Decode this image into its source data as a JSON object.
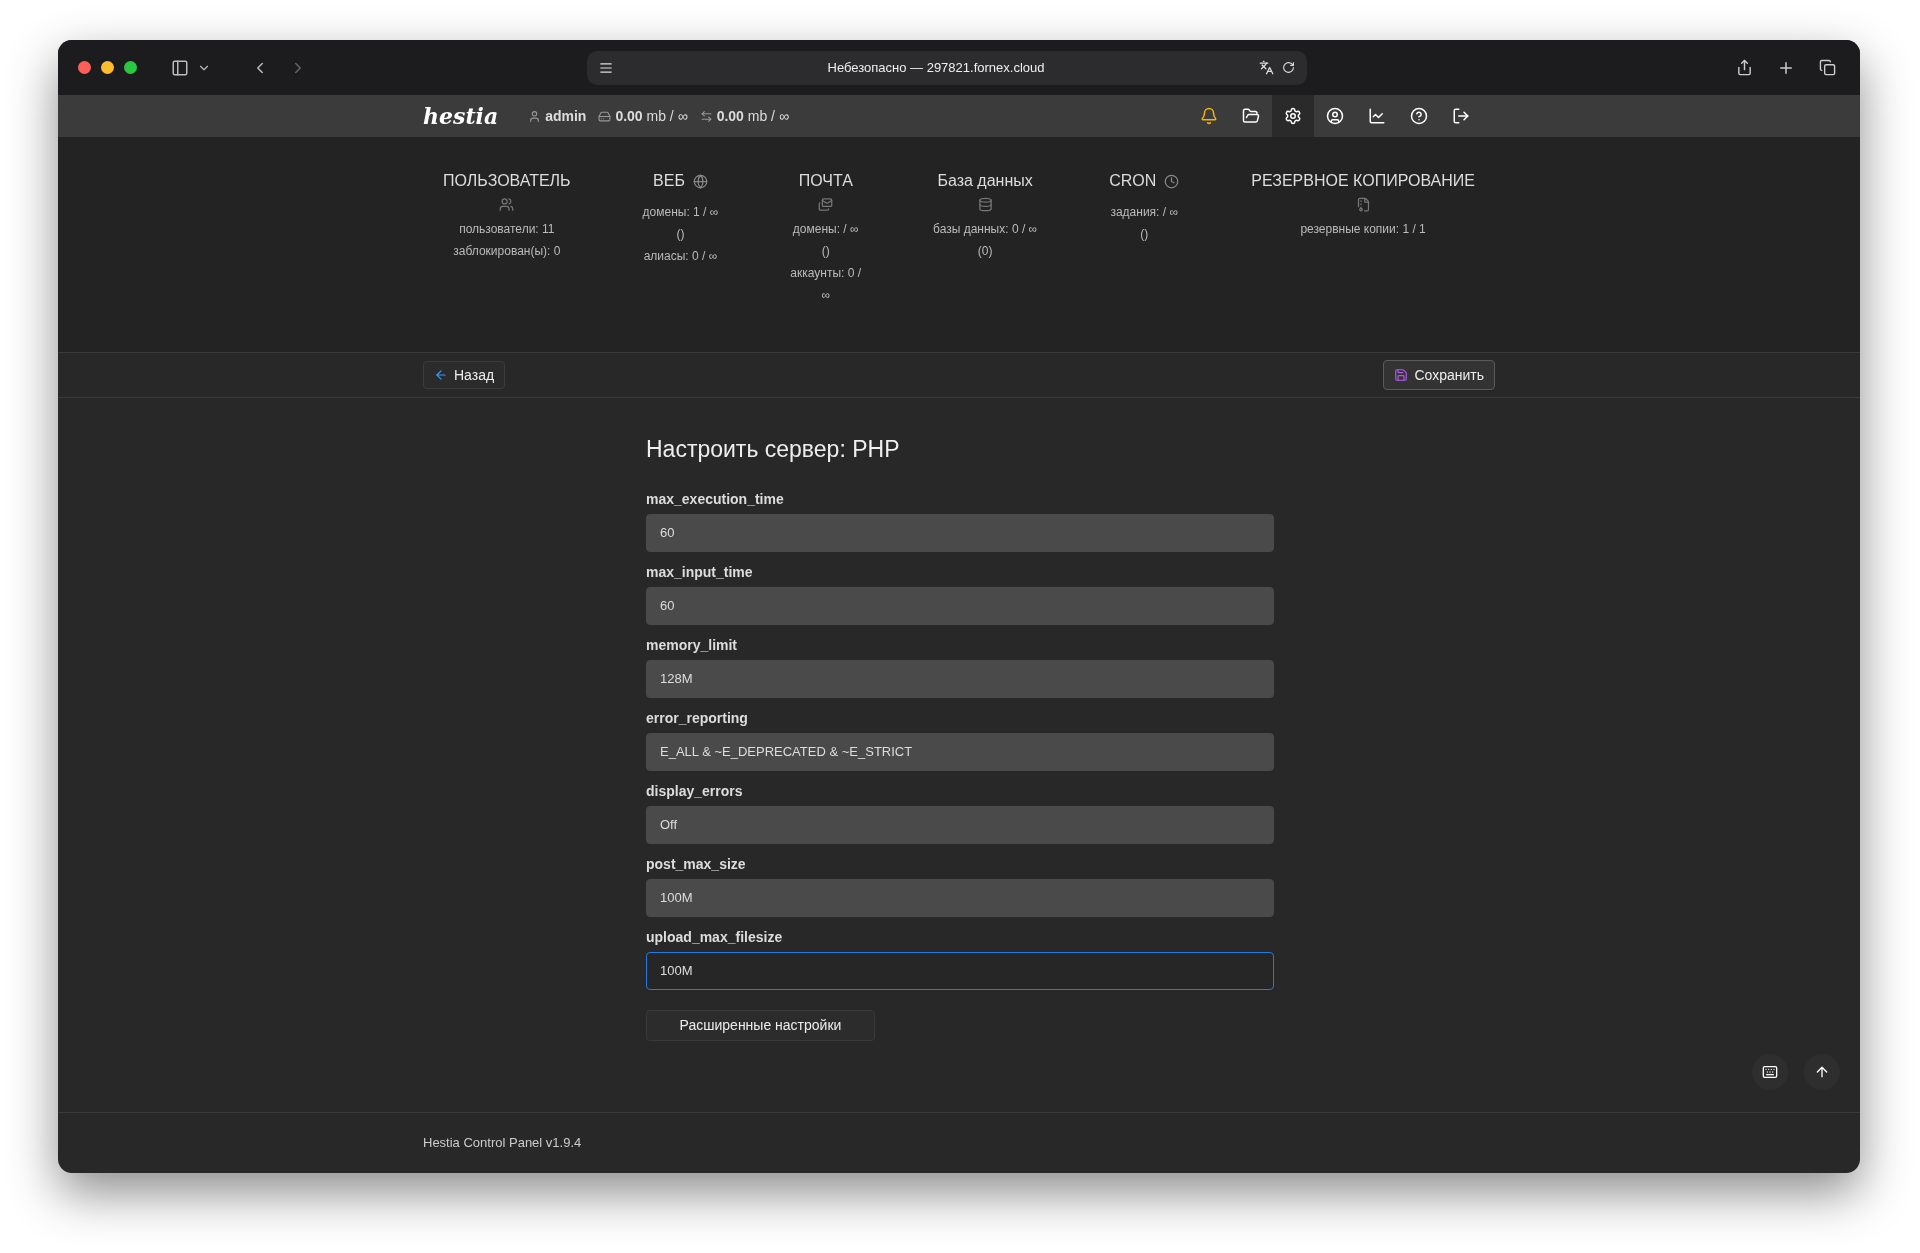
{
  "browser": {
    "address": "Небезопасно — 297821.fornex.cloud"
  },
  "topbar": {
    "logo": "hestia",
    "user": "admin",
    "disk": "0.00",
    "disk_unit": "mb / ∞",
    "bandwidth": "0.00",
    "bandwidth_unit": "mb / ∞",
    "icons": [
      {
        "kind": "bell",
        "selected": false
      },
      {
        "kind": "folder",
        "selected": false
      },
      {
        "kind": "settings",
        "selected": true
      },
      {
        "kind": "user",
        "selected": false
      },
      {
        "kind": "chart",
        "selected": false
      },
      {
        "kind": "help",
        "selected": false
      },
      {
        "kind": "logout",
        "selected": false
      }
    ]
  },
  "stats": [
    {
      "title": "ПОЛЬЗОВАТЕЛЬ",
      "kind": "users",
      "lines": [
        "пользователи: 11",
        "заблокирован(ы): 0"
      ]
    },
    {
      "title": "ВЕБ",
      "kind": "globe",
      "lines": [
        "домены: 1 / ∞",
        "()",
        "алиасы: 0 / ∞"
      ]
    },
    {
      "title": "ПОЧТА",
      "kind": "mail",
      "lines": [
        "домены: / ∞",
        "()",
        "аккаунты: 0 /",
        "∞"
      ]
    },
    {
      "title": "База данных",
      "kind": "database",
      "lines": [
        "базы данных: 0 / ∞",
        "(0)"
      ]
    },
    {
      "title": "CRON",
      "kind": "clock",
      "lines": [
        "задания: / ∞",
        "()"
      ]
    },
    {
      "title": "РЕЗЕРВНОЕ КОПИРОВАНИЕ",
      "kind": "archive",
      "lines": [
        "резервные копии: 1 / 1"
      ]
    }
  ],
  "toolbar": {
    "back": "Назад",
    "save": "Сохранить"
  },
  "form": {
    "title": "Настроить сервер: PHP",
    "fields": [
      {
        "label": "max_execution_time",
        "value": "60",
        "focused": false
      },
      {
        "label": "max_input_time",
        "value": "60",
        "focused": false
      },
      {
        "label": "memory_limit",
        "value": "128M",
        "focused": false
      },
      {
        "label": "error_reporting",
        "value": "E_ALL & ~E_DEPRECATED & ~E_STRICT",
        "focused": false
      },
      {
        "label": "display_errors",
        "value": "Off",
        "focused": false
      },
      {
        "label": "post_max_size",
        "value": "100M",
        "focused": false
      },
      {
        "label": "upload_max_filesize",
        "value": "100M",
        "focused": true
      }
    ],
    "advanced": "Расширенные настройки"
  },
  "footer": "Hestia Control Panel v1.9.4"
}
